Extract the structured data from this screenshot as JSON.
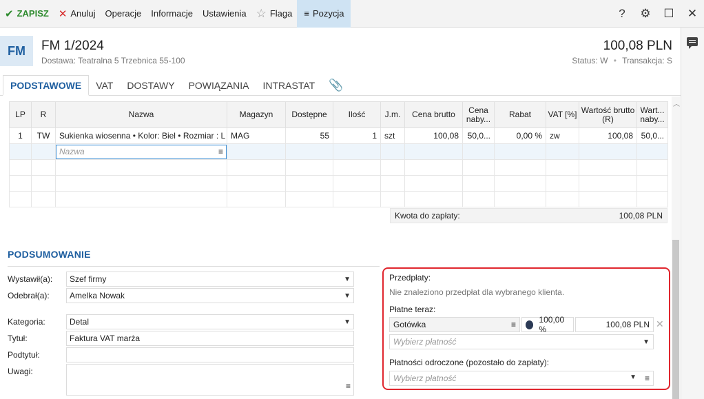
{
  "toolbar": {
    "save": "ZAPISZ",
    "cancel": "Anuluj",
    "operations": "Operacje",
    "info": "Informacje",
    "settings": "Ustawienia",
    "flag": "Flaga",
    "position": "Pozycja"
  },
  "header": {
    "badge": "FM",
    "title": "FM 1/2024",
    "subtitle": "Dostawa: Teatralna 5 Trzebnica 55-100",
    "amount": "100,08 PLN",
    "status_label": "Status:",
    "status_value": "W",
    "transaction_label": "Transakcja:",
    "transaction_value": "S"
  },
  "tabs": [
    "PODSTAWOWE",
    "VAT",
    "DOSTAWY",
    "POWIĄZANIA",
    "INTRASTAT"
  ],
  "grid": {
    "columns": [
      "LP",
      "R",
      "Nazwa",
      "Magazyn",
      "Dostępne",
      "Ilość",
      "J.m.",
      "Cena brutto",
      "Cena naby...",
      "Rabat",
      "VAT [%]",
      "Wartość brutto (R)",
      "Wart... naby..."
    ],
    "rows": [
      [
        "1",
        "TW",
        "Sukienka wiosenna • Kolor: Biel • Rozmiar : L",
        "MAG",
        "55",
        "1",
        "szt",
        "100,08",
        "50,0...",
        "0,00 %",
        "zw",
        "100,08",
        "50,0..."
      ]
    ],
    "new_row_placeholder": "Nazwa"
  },
  "total": {
    "label": "Kwota do zapłaty:",
    "value": "100,08 PLN"
  },
  "summary": {
    "title": "PODSUMOWANIE",
    "issued_by_label": "Wystawił(a):",
    "issued_by_value": "Szef firmy",
    "received_by_label": "Odebrał(a):",
    "received_by_value": "Amelka Nowak",
    "category_label": "Kategoria:",
    "category_value": "Detal",
    "title_label": "Tytuł:",
    "title_value": "Faktura VAT marża",
    "subtitle_label": "Podtytuł:",
    "subtitle_value": "",
    "notes_label": "Uwagi:",
    "notes_value": ""
  },
  "payments": {
    "prepayments_label": "Przedpłaty:",
    "prepayments_empty": "Nie znaleziono przedpłat dla wybranego klienta.",
    "pay_now_label": "Płatne teraz:",
    "method": "Gotówka",
    "percent": "100,00 %",
    "amount": "100,08 PLN",
    "choose_placeholder": "Wybierz płatność",
    "deferred_label": "Płatności odroczone (pozostało do zapłaty):",
    "deferred_placeholder": "Wybierz płatność"
  }
}
